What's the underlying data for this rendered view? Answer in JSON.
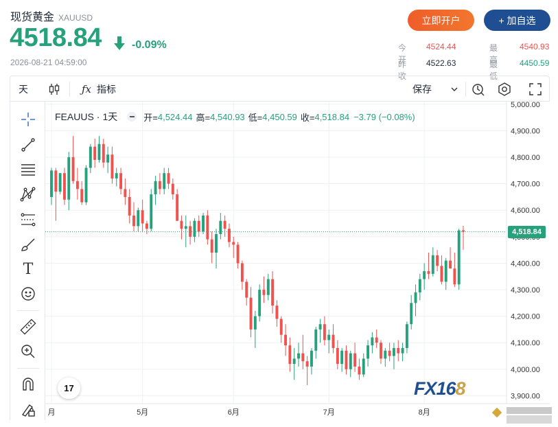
{
  "header": {
    "title": "现货黄金",
    "symbol": "XAUUSD",
    "price": "4518.84",
    "change": "-0.09%",
    "timestamp": "2026-08-21 04:59:00",
    "btn_open": "立即开户",
    "btn_watch": "+ 加自选"
  },
  "stats": {
    "open_label": "今开",
    "open_value": "4524.44",
    "high_label": "最高",
    "high_value": "4540.93",
    "prev_label": "昨收",
    "prev_value": "4522.63",
    "low_label": "最低",
    "low_value": "4450.59"
  },
  "toolbar": {
    "interval": "天",
    "indicators": "指标",
    "save": "保存"
  },
  "legend": {
    "symbol": "FEAUUS",
    "interval": "1天",
    "open_label": "开=",
    "open": "4,524.44",
    "high_label": "高=",
    "high": "4,540.93",
    "low_label": "低=",
    "low": "4,450.59",
    "close_label": "收=",
    "close": "4,518.84",
    "change": "−3.79 (−0.08%)"
  },
  "watermark": {
    "a": "FX16",
    "b": "8"
  },
  "tv_logo": "17",
  "last_price_label": "4,518.84",
  "colors": {
    "up": "#26a17b",
    "down": "#ef5350",
    "accent": "#1f4e93"
  },
  "chart_data": {
    "type": "candlestick",
    "y_ticks": [
      "5,000.00",
      "4,900.00",
      "4,800.00",
      "4,700.00",
      "4,600.00",
      "4,500.00",
      "4,400.00",
      "4,300.00",
      "4,200.00",
      "4,100.00",
      "4,000.00",
      "3,900.00"
    ],
    "y_range": [
      3870,
      5010
    ],
    "x_ticks": [
      {
        "label": "月",
        "index": 0
      },
      {
        "label": "5月",
        "index": 21
      },
      {
        "label": "6月",
        "index": 42
      },
      {
        "label": "7月",
        "index": 64
      },
      {
        "label": "8月",
        "index": 86
      }
    ],
    "last_price": 4518.84,
    "candles": [
      [
        4650,
        4760,
        4620,
        4750
      ],
      [
        4750,
        4760,
        4560,
        4670
      ],
      [
        4670,
        4740,
        4660,
        4740
      ],
      [
        4740,
        4760,
        4620,
        4640
      ],
      [
        4640,
        4820,
        4600,
        4800
      ],
      [
        4800,
        4880,
        4700,
        4710
      ],
      [
        4710,
        4760,
        4640,
        4680
      ],
      [
        4680,
        4710,
        4620,
        4630
      ],
      [
        4630,
        4770,
        4620,
        4760
      ],
      [
        4760,
        4850,
        4740,
        4840
      ],
      [
        4840,
        4870,
        4760,
        4790
      ],
      [
        4790,
        4880,
        4780,
        4850
      ],
      [
        4850,
        4870,
        4760,
        4780
      ],
      [
        4780,
        4840,
        4740,
        4810
      ],
      [
        4810,
        4840,
        4700,
        4720
      ],
      [
        4720,
        4760,
        4690,
        4740
      ],
      [
        4740,
        4760,
        4660,
        4680
      ],
      [
        4680,
        4720,
        4620,
        4650
      ],
      [
        4650,
        4680,
        4550,
        4580
      ],
      [
        4580,
        4630,
        4520,
        4540
      ],
      [
        4540,
        4610,
        4520,
        4600
      ],
      [
        4600,
        4640,
        4520,
        4550
      ],
      [
        4550,
        4560,
        4510,
        4530
      ],
      [
        4530,
        4680,
        4520,
        4660
      ],
      [
        4660,
        4730,
        4620,
        4710
      ],
      [
        4710,
        4740,
        4660,
        4680
      ],
      [
        4680,
        4760,
        4660,
        4740
      ],
      [
        4740,
        4760,
        4680,
        4700
      ],
      [
        4700,
        4720,
        4640,
        4660
      ],
      [
        4660,
        4680,
        4560,
        4560
      ],
      [
        4560,
        4580,
        4490,
        4530
      ],
      [
        4530,
        4580,
        4460,
        4540
      ],
      [
        4540,
        4560,
        4470,
        4500
      ],
      [
        4500,
        4570,
        4480,
        4560
      ],
      [
        4560,
        4580,
        4500,
        4520
      ],
      [
        4520,
        4590,
        4510,
        4580
      ],
      [
        4580,
        4600,
        4470,
        4490
      ],
      [
        4490,
        4520,
        4400,
        4440
      ],
      [
        4440,
        4530,
        4380,
        4510
      ],
      [
        4510,
        4590,
        4490,
        4560
      ],
      [
        4560,
        4580,
        4500,
        4530
      ],
      [
        4530,
        4550,
        4460,
        4480
      ],
      [
        4480,
        4500,
        4420,
        4470
      ],
      [
        4470,
        4480,
        4380,
        4400
      ],
      [
        4400,
        4410,
        4300,
        4330
      ],
      [
        4330,
        4340,
        4240,
        4270
      ],
      [
        4270,
        4310,
        4120,
        4150
      ],
      [
        4150,
        4220,
        4080,
        4200
      ],
      [
        4200,
        4320,
        4180,
        4300
      ],
      [
        4300,
        4350,
        4250,
        4280
      ],
      [
        4280,
        4360,
        4260,
        4340
      ],
      [
        4340,
        4370,
        4210,
        4240
      ],
      [
        4240,
        4260,
        4160,
        4190
      ],
      [
        4190,
        4200,
        4100,
        4130
      ],
      [
        4130,
        4170,
        4050,
        4090
      ],
      [
        4090,
        4120,
        3990,
        4020
      ],
      [
        4020,
        4080,
        3960,
        4040
      ],
      [
        4040,
        4100,
        4010,
        4060
      ],
      [
        4060,
        4130,
        4000,
        4030
      ],
      [
        4030,
        4050,
        3940,
        4010
      ],
      [
        4010,
        4080,
        3980,
        4070
      ],
      [
        4070,
        4160,
        4040,
        4150
      ],
      [
        4150,
        4190,
        4100,
        4170
      ],
      [
        4170,
        4200,
        4090,
        4110
      ],
      [
        4110,
        4150,
        4060,
        4130
      ],
      [
        4130,
        4170,
        4060,
        4080
      ],
      [
        4080,
        4110,
        4000,
        4020
      ],
      [
        4020,
        4080,
        3990,
        4070
      ],
      [
        4070,
        4090,
        3980,
        4000
      ],
      [
        4000,
        4070,
        3970,
        4060
      ],
      [
        4060,
        4100,
        3990,
        4010
      ],
      [
        4010,
        4040,
        3960,
        3980
      ],
      [
        3980,
        4060,
        3970,
        4040
      ],
      [
        4040,
        4110,
        4010,
        4090
      ],
      [
        4090,
        4140,
        4060,
        4120
      ],
      [
        4120,
        4150,
        4080,
        4100
      ],
      [
        4100,
        4110,
        4020,
        4040
      ],
      [
        4040,
        4080,
        4010,
        4070
      ],
      [
        4070,
        4100,
        4030,
        4050
      ],
      [
        4050,
        4100,
        4000,
        4080
      ],
      [
        4080,
        4110,
        4030,
        4060
      ],
      [
        4060,
        4100,
        4030,
        4080
      ],
      [
        4080,
        4180,
        4060,
        4170
      ],
      [
        4170,
        4280,
        4150,
        4250
      ],
      [
        4250,
        4320,
        4200,
        4290
      ],
      [
        4290,
        4360,
        4260,
        4340
      ],
      [
        4340,
        4400,
        4300,
        4370
      ],
      [
        4370,
        4440,
        4340,
        4360
      ],
      [
        4360,
        4460,
        4350,
        4430
      ],
      [
        4430,
        4450,
        4370,
        4390
      ],
      [
        4390,
        4430,
        4320,
        4330
      ],
      [
        4330,
        4420,
        4300,
        4410
      ],
      [
        4410,
        4460,
        4380,
        4380
      ],
      [
        4380,
        4440,
        4310,
        4320
      ],
      [
        4320,
        4530,
        4300,
        4524
      ],
      [
        4524.44,
        4540.93,
        4450.59,
        4518.84
      ]
    ]
  }
}
